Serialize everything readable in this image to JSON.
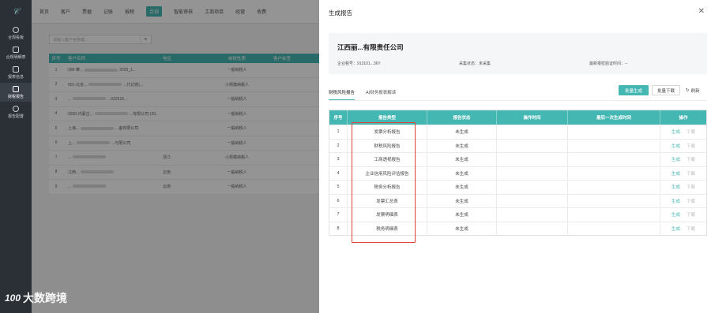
{
  "sidebar": {
    "items": [
      {
        "label": "合规看板",
        "icon": "clock-icon"
      },
      {
        "label": "合规明细表",
        "icon": "calendar-icon"
      },
      {
        "label": "报表信息",
        "icon": "monitor-icon"
      },
      {
        "label": "财税报告",
        "icon": "clipboard-icon"
      },
      {
        "label": "报告配置",
        "icon": "gear-icon"
      }
    ],
    "watermark": "大数跨境",
    "watermark_logo": "100"
  },
  "topnav": {
    "items": [
      "首页",
      "客户",
      "票据",
      "记账",
      "报税",
      "合规",
      "智能审核",
      "工商项目",
      "经营",
      "收费"
    ],
    "active": "合规"
  },
  "background": {
    "search_placeholder": "请输入客户名称或...",
    "search_icon": "search-icon",
    "headers": [
      "序号",
      "客户名称",
      "地区",
      "纳税性质",
      "客户标签"
    ],
    "rows": [
      {
        "no": "1",
        "name": "006-華...",
        "tail": "2025_1...",
        "region": "",
        "type": "一般纳税人"
      },
      {
        "no": "2",
        "name": "001-北京...",
        "tail": "...代记账(...",
        "region": "",
        "type": "小规模纳税人"
      },
      {
        "no": "3",
        "name": "...",
        "tail": "...022515...",
        "region": "",
        "type": "一般纳税人"
      },
      {
        "no": "4",
        "name": "0030-内蒙古...",
        "tail": "...有限公司-(20...",
        "region": "",
        "type": "一般纳税人"
      },
      {
        "no": "5",
        "name": "上海...",
        "tail": "...备有限公司",
        "region": "",
        "type": "一般纳税人"
      },
      {
        "no": "6",
        "name": "上...",
        "tail": "...与限公司",
        "region": "",
        "type": "一般纳税人"
      },
      {
        "no": "7",
        "name": "...",
        "tail": "",
        "region": "浙江",
        "type": "小规模纳税人"
      },
      {
        "no": "8",
        "name": "江西...",
        "tail": "",
        "region": "云南",
        "type": "一般纳税人"
      },
      {
        "no": "9",
        "name": "...",
        "tail": "",
        "region": "云南",
        "type": "一般纳税人"
      }
    ]
  },
  "drawer": {
    "title": "生成报告",
    "close_icon": "close-icon",
    "company": {
      "name": "江西丽...有限责任公司",
      "tax_id_label": "企业税号：",
      "tax_id_value": "913101...36Y",
      "collect_label": "采集状态：",
      "collect_value": "未采集",
      "last_verify_label": "最新报密验证时间：",
      "last_verify_value": "--"
    },
    "tabs": [
      "财税风险报告",
      "AI财务报表解读"
    ],
    "buttons": {
      "batch_generate": "批量生成",
      "batch_download": "批量下载",
      "refresh": "刷新",
      "refresh_icon": "refresh-icon"
    },
    "table": {
      "headers": [
        "序号",
        "报告类型",
        "报告状态",
        "操作时间",
        "最后一次生成时间",
        "操作"
      ],
      "rows": [
        {
          "no": "1",
          "type": "发票分析报告",
          "status": "未生成",
          "op_time": "",
          "last_time": "",
          "gen": "生成",
          "dl": "下载"
        },
        {
          "no": "2",
          "type": "财税风险报告",
          "status": "未生成",
          "op_time": "",
          "last_time": "",
          "gen": "生成",
          "dl": "下载"
        },
        {
          "no": "3",
          "type": "工商透视报告",
          "status": "未生成",
          "op_time": "",
          "last_time": "",
          "gen": "生成",
          "dl": "下载"
        },
        {
          "no": "4",
          "type": "企业信用风险评估报告",
          "status": "未生成",
          "op_time": "",
          "last_time": "",
          "gen": "生成",
          "dl": "下载"
        },
        {
          "no": "5",
          "type": "税务分析报告",
          "status": "未生成",
          "op_time": "",
          "last_time": "",
          "gen": "生成",
          "dl": "下载"
        },
        {
          "no": "6",
          "type": "发票汇总表",
          "status": "未生成",
          "op_time": "",
          "last_time": "",
          "gen": "生成",
          "dl": "下载"
        },
        {
          "no": "7",
          "type": "发票明细表",
          "status": "未生成",
          "op_time": "",
          "last_time": "",
          "gen": "生成",
          "dl": "下载"
        },
        {
          "no": "8",
          "type": "税务明细表",
          "status": "未生成",
          "op_time": "",
          "last_time": "",
          "gen": "生成",
          "dl": "下载"
        }
      ]
    }
  },
  "colors": {
    "accent": "#45b7b3",
    "sidebar_bg": "#2b2f36",
    "highlight": "#e0443c"
  }
}
